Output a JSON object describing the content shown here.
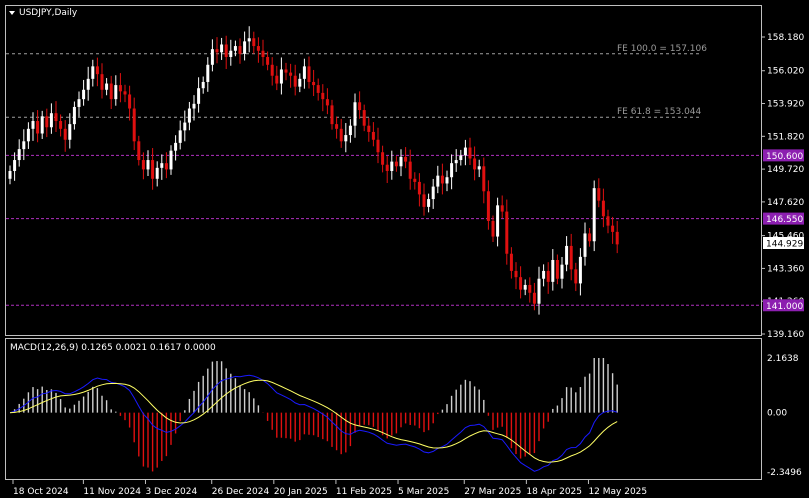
{
  "symbol_title": "USDJPY,Daily",
  "colors": {
    "background": "#000000",
    "frame": "#bfbfbf",
    "bull": "#ffffff",
    "bear": "#e01010",
    "macd_line": "#1a1aff",
    "signal_line": "#ffff66",
    "level_line": "#b030c0",
    "level_label_bg": "#8c1fb0",
    "fib_line": "#a0a0a0",
    "current_label_bg": "#ffffff"
  },
  "price_axis": {
    "ticks": [
      "158.180",
      "156.020",
      "153.920",
      "151.820",
      "149.720",
      "147.620",
      "145.460",
      "143.360",
      "141.260",
      "139.160"
    ],
    "current_price": "144.929"
  },
  "levels": [
    {
      "label": "150.600",
      "price": 150.6
    },
    {
      "label": "146.550",
      "price": 146.55
    },
    {
      "label": "141.000",
      "price": 141.0
    }
  ],
  "fib_levels": [
    {
      "label": "FE 100.0 = 157.106",
      "price": 157.106
    },
    {
      "label": "FE 61.8 = 153.044",
      "price": 153.044
    }
  ],
  "macd_panel": {
    "label": "MACD(12,26,9) 0.1265 0.0021 0.1617 0.0000",
    "ticks": [
      "2.1638",
      "0.00",
      "-2.3496"
    ]
  },
  "date_axis": [
    "18 Oct 2024",
    "11 Nov 2024",
    "3 Dec 2024",
    "26 Dec 2024",
    "20 Jan 2025",
    "11 Feb 2025",
    "5 Mar 2025",
    "27 Mar 2025",
    "18 Apr 2025",
    "12 May 2025"
  ],
  "chart_data": {
    "type": "candlestick",
    "symbol": "USDJPY",
    "timeframe": "Daily",
    "y_range": [
      139.16,
      158.18
    ],
    "x_start_date": "2024-10-18",
    "closes": [
      149.6,
      150.3,
      151.0,
      151.5,
      152.3,
      152.8,
      152.0,
      153.1,
      152.4,
      153.3,
      152.8,
      152.3,
      151.6,
      152.6,
      153.7,
      154.2,
      154.8,
      155.5,
      156.3,
      155.8,
      154.8,
      155.2,
      154.2,
      155.1,
      154.7,
      154.5,
      153.6,
      151.5,
      150.3,
      149.7,
      150.3,
      149.1,
      149.8,
      150.1,
      149.7,
      150.9,
      151.4,
      152.2,
      152.7,
      153.6,
      153.9,
      154.9,
      155.3,
      156.4,
      157.4,
      157.2,
      157.7,
      156.9,
      157.3,
      157.6,
      157.1,
      157.9,
      158.1,
      157.6,
      157.3,
      156.9,
      156.4,
      155.7,
      155.2,
      156.1,
      155.9,
      155.7,
      155.0,
      155.5,
      156.3,
      155.3,
      155.1,
      154.6,
      154.2,
      153.8,
      152.6,
      152.3,
      151.5,
      151.9,
      152.5,
      154.0,
      153.5,
      152.5,
      152.1,
      151.6,
      150.8,
      150.0,
      149.6,
      150.2,
      149.9,
      150.5,
      150.2,
      149.1,
      148.9,
      148.1,
      147.3,
      147.8,
      148.6,
      149.3,
      148.8,
      149.2,
      150.1,
      150.3,
      150.6,
      151.1,
      150.4,
      149.7,
      149.9,
      148.3,
      146.4,
      145.4,
      147.4,
      147.0,
      144.3,
      143.2,
      142.8,
      142.0,
      142.3,
      141.8,
      141.1,
      142.7,
      143.2,
      142.5,
      143.9,
      142.7,
      143.6,
      144.8,
      143.3,
      142.4,
      144.1,
      145.6,
      145.1,
      148.5,
      147.7,
      146.7,
      146.1,
      145.7,
      144.9
    ]
  }
}
